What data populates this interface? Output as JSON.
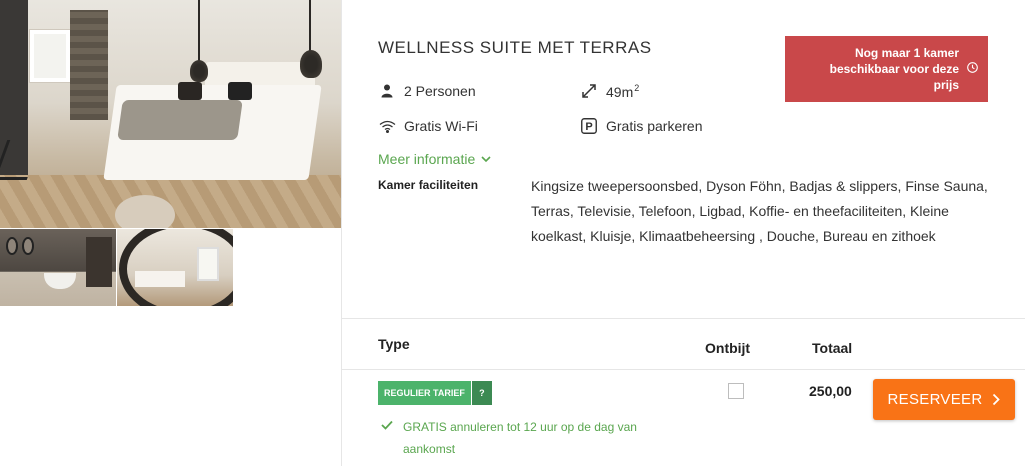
{
  "room": {
    "title": "WELLNESS SUITE MET TERRAS",
    "features": {
      "persons": "2 Personen",
      "size": "49m",
      "size_sup": "2",
      "wifi": "Gratis Wi-Fi",
      "parking": "Gratis parkeren"
    },
    "more_info": "Meer informatie",
    "facilities_label": "Kamer faciliteiten",
    "facilities_text": "Kingsize tweepersoonsbed, Dyson Föhn, Badjas & slippers, Finse Sauna, Terras, Televisie, Telefoon, Ligbad, Koffie- en theefaciliteiten, Kleine koelkast, Kluisje, Klimaatbeheersing , Douche, Bureau en zithoek"
  },
  "availability": {
    "text": "Nog maar 1 kamer beschikbaar voor deze prijs",
    "icon": "clock-icon"
  },
  "table": {
    "headers": {
      "type": "Type",
      "breakfast": "Ontbijt",
      "total": "Totaal"
    },
    "rate": {
      "badge": "REGULIER TARIEF",
      "help": "?",
      "price": "250,00",
      "cancellation": "GRATIS annuleren tot 12 uur op de dag van aankomst",
      "breakfast_checked": false
    },
    "reserve_button": "RESERVEER"
  },
  "colors": {
    "accent_green": "#5aa64f",
    "badge_green": "#4cb36b",
    "alert_red": "#c9484a",
    "cta_orange": "#f97316"
  }
}
